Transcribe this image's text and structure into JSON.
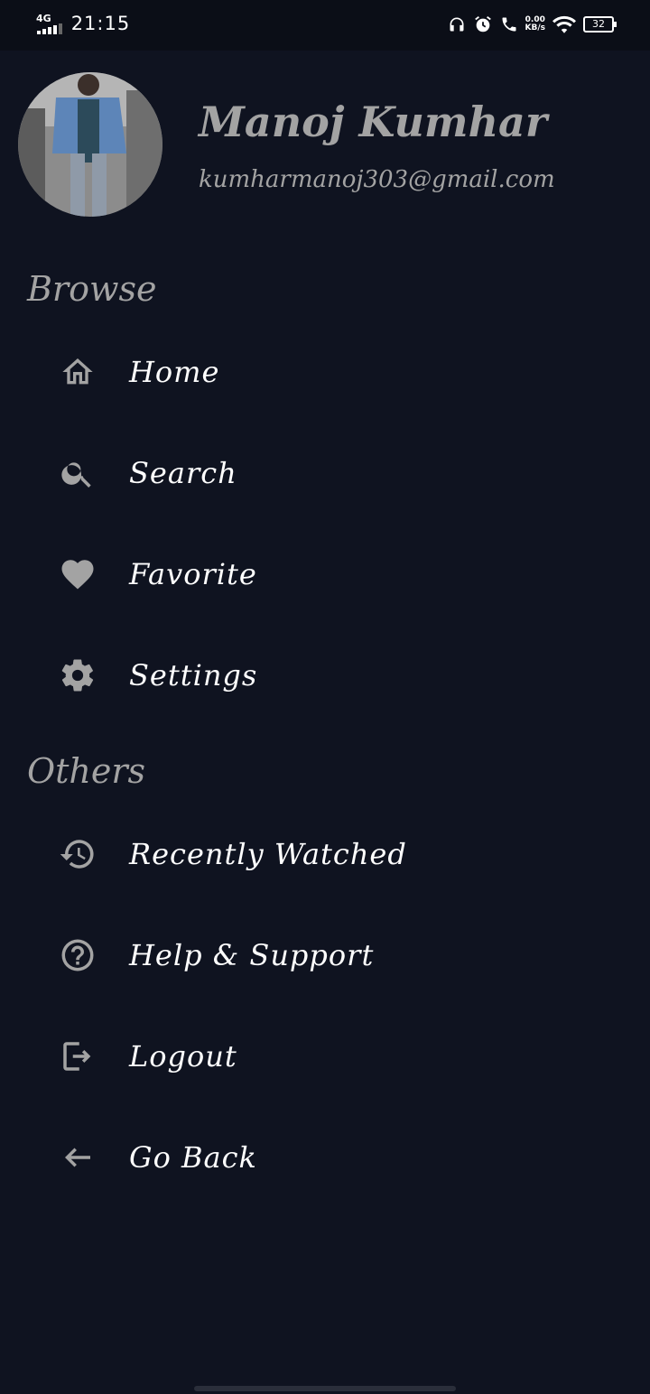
{
  "status_bar": {
    "network": "4G",
    "time": "21:15",
    "speed_value": "0.00",
    "speed_unit": "KB/s",
    "battery": "32"
  },
  "profile": {
    "name": "Manoj Kumhar",
    "email": "kumharmanoj303@gmail.com"
  },
  "sections": {
    "browse": "Browse",
    "others": "Others"
  },
  "browse_items": [
    {
      "label": "Home",
      "icon": "home-icon"
    },
    {
      "label": "Search",
      "icon": "search-icon"
    },
    {
      "label": "Favorite",
      "icon": "heart-icon"
    },
    {
      "label": "Settings",
      "icon": "gear-icon"
    }
  ],
  "other_items": [
    {
      "label": "Recently Watched",
      "icon": "history-icon"
    },
    {
      "label": "Help & Support",
      "icon": "help-icon"
    },
    {
      "label": "Logout",
      "icon": "logout-icon"
    },
    {
      "label": "Go Back",
      "icon": "back-arrow-icon"
    }
  ],
  "colors": {
    "background": "#0f1320",
    "muted_text": "#a3a3a3",
    "icon": "#a3a3a3",
    "text": "#ffffff"
  }
}
